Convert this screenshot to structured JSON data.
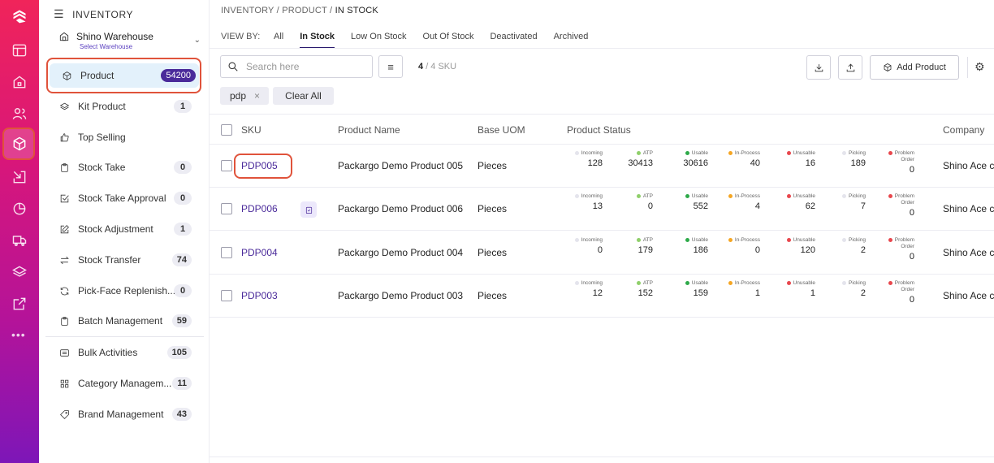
{
  "rail": {
    "icons": [
      "logo-icon",
      "layout-icon",
      "home-icon",
      "users-icon",
      "box-icon",
      "inbound-icon",
      "chart-icon",
      "truck-icon",
      "layers-icon",
      "external-icon",
      "more-icon"
    ],
    "active": "box-icon",
    "more_text": "•••",
    "accent_colors": [
      "#f0245a",
      "#7d16b8"
    ]
  },
  "sidebar": {
    "title": "INVENTORY",
    "warehouse": {
      "name": "Shino Warehouse",
      "sub": "Select Warehouse"
    },
    "items": [
      {
        "label": "Product",
        "count": "54200",
        "icon": "box-icon",
        "active": true
      },
      {
        "label": "Kit Product",
        "count": "1",
        "icon": "layers-icon"
      },
      {
        "label": "Top Selling",
        "count": "",
        "icon": "thumbs-up-icon"
      },
      {
        "label": "Stock Take",
        "count": "0",
        "icon": "clipboard-icon"
      },
      {
        "label": "Stock Take Approval",
        "count": "0",
        "icon": "check-square-icon"
      },
      {
        "label": "Stock Adjustment",
        "count": "1",
        "icon": "edit-icon"
      },
      {
        "label": "Stock Transfer",
        "count": "74",
        "icon": "transfer-icon"
      },
      {
        "label": "Pick-Face Replenish...",
        "count": "0",
        "icon": "refresh-icon"
      },
      {
        "label": "Batch Management",
        "count": "59",
        "icon": "clipboard-icon"
      },
      {
        "label": "Bulk Activities",
        "count": "105",
        "icon": "list-icon"
      },
      {
        "label": "Category Managem...",
        "count": "11",
        "icon": "grid-icon"
      },
      {
        "label": "Brand Management",
        "count": "43",
        "icon": "tag-icon"
      }
    ]
  },
  "breadcrumb": {
    "a": "INVENTORY",
    "sep": "/",
    "b": "PRODUCT",
    "c": "IN STOCK"
  },
  "view_by": {
    "label": "VIEW BY:",
    "tabs": [
      "All",
      "In Stock",
      "Low On Stock",
      "Out Of Stock",
      "Deactivated",
      "Archived"
    ],
    "active": "In Stock"
  },
  "toolbar": {
    "search_placeholder": "Search here",
    "sku_count": "4",
    "sku_total": "/ 4 SKU",
    "add_label": "Add Product",
    "gear": "⚙",
    "filter": "≡"
  },
  "filters": {
    "chip": "pdp",
    "chip_x": "×",
    "clear": "Clear All"
  },
  "table": {
    "headers": [
      "SKU",
      "Product Name",
      "Base UOM",
      "Product Status",
      "Company"
    ],
    "status_labels": [
      "Incoming",
      "ATP",
      "Usable",
      "In-Process",
      "Unusable",
      "Picking",
      "Problem Order"
    ],
    "status_colors": [
      "#e4e4ec",
      "#8fcf6a",
      "#2eaa4a",
      "#f5a623",
      "#e8474d",
      "#e4e4ec",
      "#e8474d"
    ],
    "rows": [
      {
        "sku": "PDP005",
        "name": "Packargo Demo Product 005",
        "uom": "Pieces",
        "stats": [
          "128",
          "30413",
          "30616",
          "40",
          "16",
          "189",
          "0"
        ],
        "company": "Shino Ace cu",
        "note": false
      },
      {
        "sku": "PDP006",
        "name": "Packargo Demo Product 006",
        "uom": "Pieces",
        "stats": [
          "13",
          "0",
          "552",
          "4",
          "62",
          "7",
          "0"
        ],
        "company": "Shino Ace cu",
        "note": true
      },
      {
        "sku": "PDP004",
        "name": "Packargo Demo Product 004",
        "uom": "Pieces",
        "stats": [
          "0",
          "179",
          "186",
          "0",
          "120",
          "2",
          "0"
        ],
        "company": "Shino Ace cu",
        "note": false
      },
      {
        "sku": "PDP003",
        "name": "Packargo Demo Product 003",
        "uom": "Pieces",
        "stats": [
          "12",
          "152",
          "159",
          "1",
          "1",
          "2",
          "0"
        ],
        "company": "Shino Ace cu",
        "note": false
      }
    ]
  }
}
